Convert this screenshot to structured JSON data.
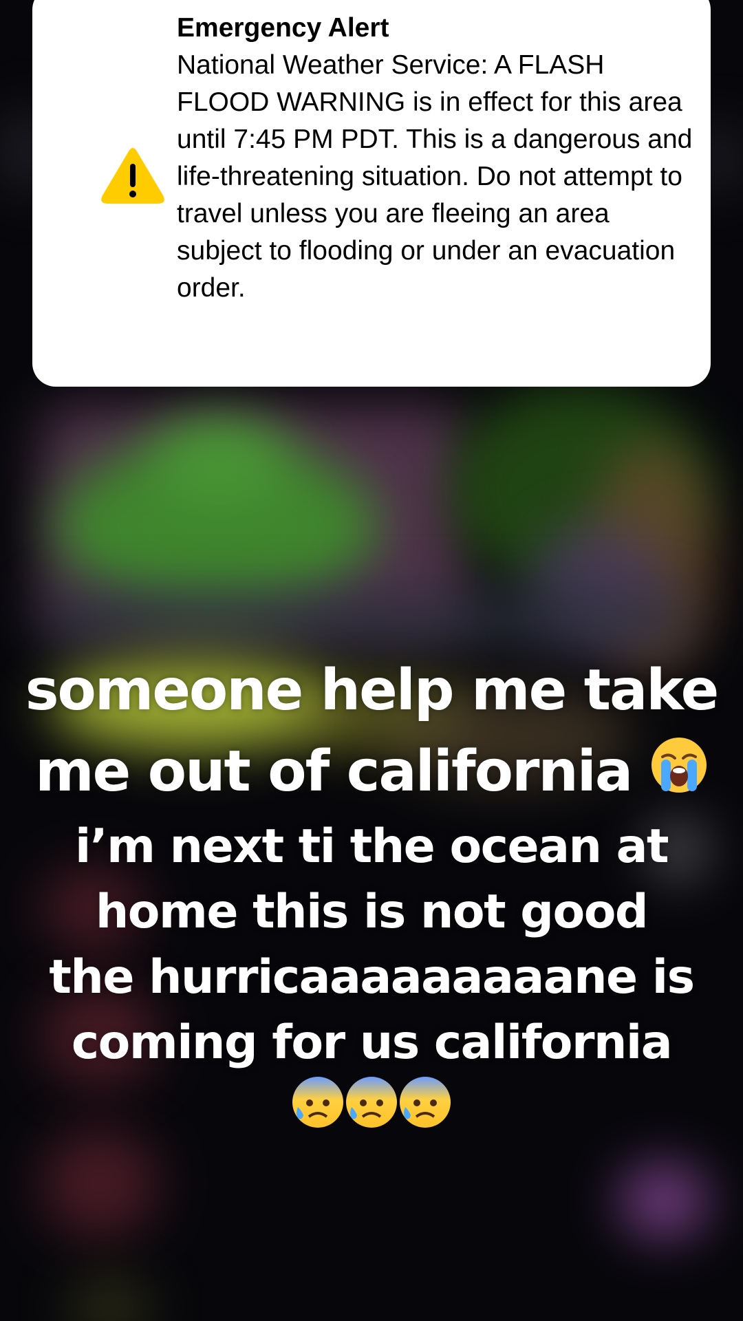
{
  "alert": {
    "title": "Emergency Alert",
    "body": "National Weather Service: A FLASH FLOOD WARNING is in effect for this area until 7:45 PM PDT. This is a dangerous and life-threatening situation. Do not attempt to travel unless you are fleeing an area subject to flooding or under an evacuation order.",
    "icon": "warning-triangle-icon",
    "icon_color": "#FFCC00"
  },
  "caption": {
    "line1": "someone help me take",
    "line2": "me out of california",
    "line2_emoji": "loudly-crying-face-emoji",
    "line3": "i’m next ti the ocean at",
    "line4": "home this is not good",
    "line5": "the hurricaaaaaaaaane  is",
    "line6": "coming for us california",
    "line7_emoji": "anxious-face-with-sweat-emoji",
    "line7_count": 3
  },
  "colors": {
    "background": "#07070B",
    "card": "#FFFFFF",
    "caption_text": "#FFFFFF"
  }
}
